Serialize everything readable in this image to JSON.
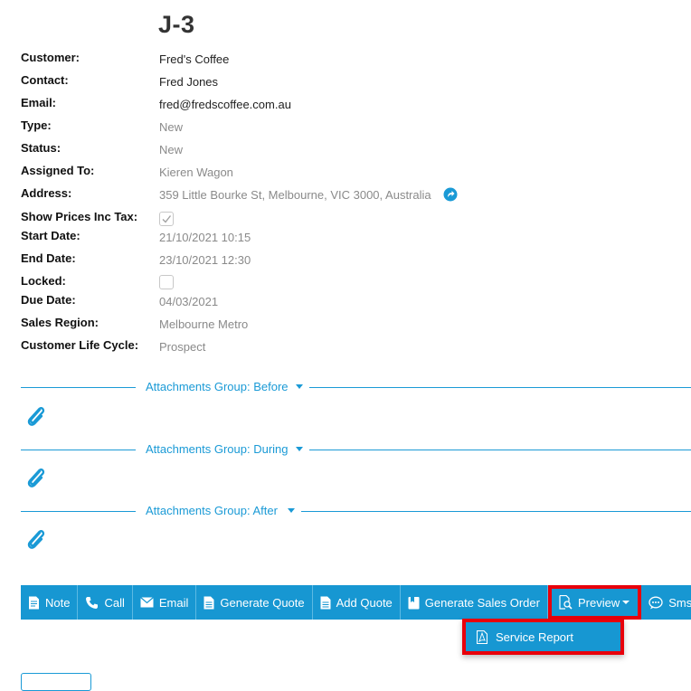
{
  "job": {
    "title": "J-3"
  },
  "fields": [
    {
      "label": "Customer:",
      "value": "Fred's Coffee"
    },
    {
      "label": "Contact:",
      "value": "Fred Jones"
    },
    {
      "label": "Email:",
      "value": "fred@fredscoffee.com.au"
    },
    {
      "label": "Type:",
      "value": "New"
    },
    {
      "label": "Status:",
      "value": "New"
    },
    {
      "label": "Assigned To:",
      "value": "Kieren Wagon"
    },
    {
      "label": "Address:",
      "value": "359 Little Bourke St, Melbourne, VIC 3000, Australia"
    },
    {
      "label": "Show Prices Inc Tax:",
      "checked": true
    },
    {
      "label": "Start Date:",
      "value": "21/10/2021 10:15"
    },
    {
      "label": "End Date:",
      "value": "23/10/2021 12:30"
    },
    {
      "label": "Locked:",
      "checked": false
    },
    {
      "label": "Due Date:",
      "value": "04/03/2021"
    },
    {
      "label": "Sales Region:",
      "value": "Melbourne Metro"
    },
    {
      "label": "Customer Life Cycle:",
      "value": "Prospect"
    }
  ],
  "attachment_groups": [
    {
      "label": "Attachments Group: Before"
    },
    {
      "label": "Attachments Group: During"
    },
    {
      "label": "Attachments Group: After"
    }
  ],
  "toolbar": {
    "note": "Note",
    "call": "Call",
    "email": "Email",
    "generate_quote": "Generate Quote",
    "add_quote": "Add Quote",
    "generate_sales_order": "Generate Sales Order",
    "preview": "Preview",
    "sms": "Sms"
  },
  "preview_menu": {
    "service_report": "Service Report"
  },
  "icons": {
    "map": "navigate-icon",
    "attachment": "paperclip-icon",
    "note": "note-icon",
    "call": "phone-icon",
    "email": "envelope-icon",
    "quote": "document-icon",
    "sales_order": "book-icon",
    "preview": "preview-icon",
    "sms": "sms-icon",
    "report": "pdf-icon"
  },
  "colors": {
    "accent": "#1797d2",
    "highlight": "#e8000b",
    "muted_text": "#8a8a8a"
  }
}
